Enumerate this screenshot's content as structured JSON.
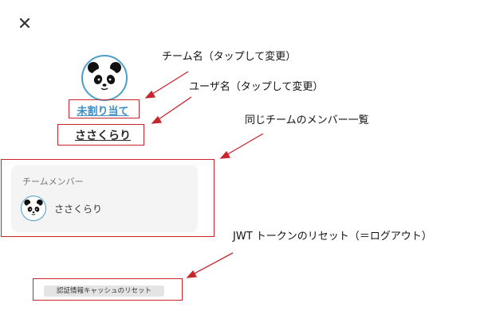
{
  "header": {
    "close_icon": "close-icon"
  },
  "profile": {
    "team_name": "未割り当て",
    "user_name": "ささくらり"
  },
  "members": {
    "title": "チームメンバー",
    "items": [
      {
        "name": "ささくらり",
        "avatar": "panda-avatar"
      }
    ]
  },
  "actions": {
    "reset_label": "認証情報キャッシュのリセット"
  },
  "annotations": {
    "team_name_note": "チーム名（タップして変更）",
    "user_name_note": "ユーザ名（タップして変更）",
    "members_note": "同じチームのメンバー一覧",
    "reset_note": "JWT トークンのリセット（＝ログアウト）"
  },
  "colors": {
    "accent": "#3d8fc4",
    "avatar_border": "#4a9fc8",
    "annotation_red": "#c8252d",
    "panel_bg": "#f4f4f4"
  }
}
